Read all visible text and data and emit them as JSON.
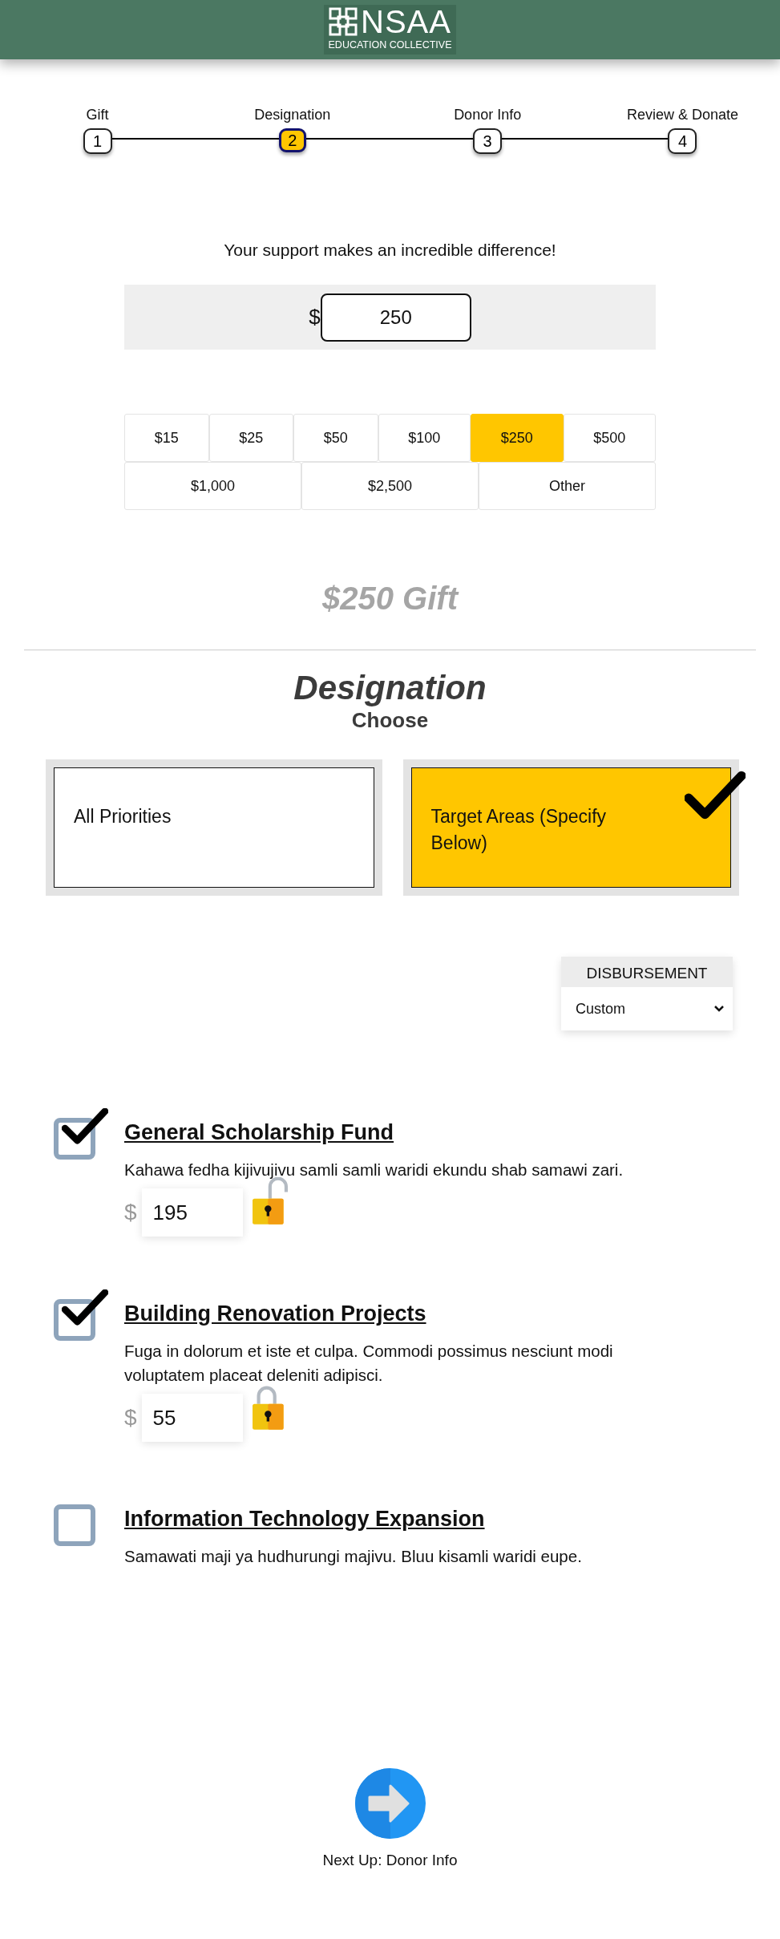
{
  "header": {
    "logo_title": "NSAA",
    "logo_subtitle": "EDUCATION COLLECTIVE"
  },
  "steps": [
    {
      "label": "Gift",
      "number": "1",
      "selected": false
    },
    {
      "label": "Designation",
      "number": "2",
      "selected": true
    },
    {
      "label": "Donor Info",
      "number": "3",
      "selected": false
    },
    {
      "label": "Review & Donate",
      "number": "4",
      "selected": false
    }
  ],
  "tagline": "Your support makes an incredible difference!",
  "amount": {
    "currency": "$",
    "value": "250"
  },
  "preset_rows": [
    [
      {
        "label": "$15",
        "selected": false
      },
      {
        "label": "$25",
        "selected": false
      },
      {
        "label": "$50",
        "selected": false
      },
      {
        "label": "$100",
        "selected": false
      },
      {
        "label": "$250",
        "selected": true
      },
      {
        "label": "$500",
        "selected": false
      }
    ],
    [
      {
        "label": "$1,000",
        "selected": false
      },
      {
        "label": "$2,500",
        "selected": false
      },
      {
        "label": "Other",
        "selected": false
      }
    ]
  ],
  "gift_summary": "$250 Gift",
  "designation": {
    "title": "Designation",
    "subtitle": "Choose",
    "options": [
      {
        "label": "All Priorities",
        "selected": false
      },
      {
        "label": "Target Areas (Specify Below)",
        "selected": true
      }
    ]
  },
  "disbursement": {
    "label": "DISBURSEMENT",
    "value": "Custom"
  },
  "funds": [
    {
      "title": "General Scholarship Fund",
      "description": "Kahawa fedha kijivujivu samli samli waridi ekundu shab samawi zari.",
      "checked": true,
      "currency": "$",
      "amount": "195",
      "locked": false
    },
    {
      "title": "Building Renovation Projects",
      "description": "Fuga in dolorum et iste et culpa. Commodi possimus nesciunt modi voluptatem placeat deleniti adipisci.",
      "checked": true,
      "currency": "$",
      "amount": "55",
      "locked": true
    },
    {
      "title": "Information Technology Expansion",
      "description": "Samawati maji ya hudhurungi majivu. Bluu kisamli waridi eupe.",
      "checked": false
    }
  ],
  "next": {
    "label": "Next Up: Donor Info"
  }
}
